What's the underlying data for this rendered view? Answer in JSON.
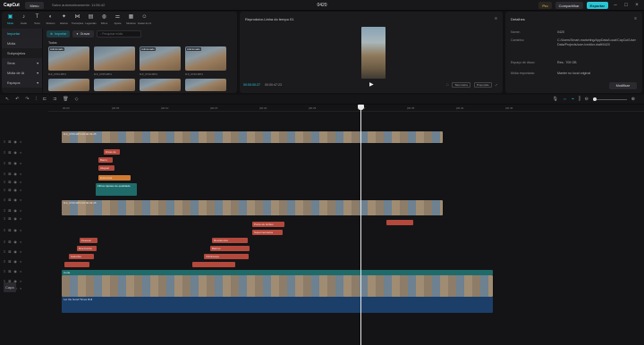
{
  "app": {
    "logo": "CapCut",
    "menu": "Menu",
    "save_status": "Salvo automaticamente: 11:56:42",
    "project": "0420"
  },
  "topbar": {
    "pro": "Pro",
    "share": "Compartilhar",
    "export": "Exportar"
  },
  "tools": [
    {
      "icon": "▣",
      "label": "Mídia"
    },
    {
      "icon": "♪",
      "label": "Áudio"
    },
    {
      "icon": "T",
      "label": "Texto"
    },
    {
      "icon": "◐",
      "label": "Stickers"
    },
    {
      "icon": "✦",
      "label": "Efeitos"
    },
    {
      "icon": "⋈",
      "label": "Transições"
    },
    {
      "icon": "▤",
      "label": "Legendas"
    },
    {
      "icon": "◍",
      "label": "Filtros"
    },
    {
      "icon": "⚌",
      "label": "Ajuste"
    },
    {
      "icon": "▦",
      "label": "Modelos"
    },
    {
      "icon": "☺",
      "label": "Avatar de IA"
    }
  ],
  "media_sidebar": [
    {
      "label": "Importar",
      "active": true
    },
    {
      "label": "Mídia",
      "active": false,
      "sub": true
    },
    {
      "label": "Subprojetos",
      "active": false
    },
    {
      "label": "Seus",
      "active": false,
      "caret": "▾",
      "sub": true
    },
    {
      "label": "Mídia de IA",
      "active": false,
      "caret": "▾",
      "sub": true
    },
    {
      "label": "Espaços",
      "active": false,
      "caret": "▾",
      "sub": true
    }
  ],
  "media_main": {
    "import_btn": "Importar",
    "record_btn": "Gravar",
    "search_placeholder": "Pesquisar mídia",
    "filter_label": "Todos",
    "items": [
      {
        "badge": "Adicionado",
        "name": "DJI_0703.MP4"
      },
      {
        "badge": "",
        "name": "DJI_0705.MP4"
      },
      {
        "badge": "Adicionado",
        "name": "DJI_0710.MP4"
      },
      {
        "badge": "Adicionado",
        "name": "DJI_0720.MP4"
      }
    ]
  },
  "player": {
    "title": "Reprodutor-Linha do tempo 01",
    "tc_current": "00:00:00:27",
    "tc_total": "00:00:47:23",
    "play": "▶",
    "ratio": "Proporção",
    "fullscreen": "Tela inteira"
  },
  "details": {
    "title": "Detalhes",
    "rows": [
      {
        "k": "Nome:",
        "v": "0420"
      },
      {
        "k": "Caminho:",
        "v": "C:/Users/Smart-marketing/AppData/Local/CapCut/User Data/Projects/com.lveditor.draft/0420"
      },
      {
        "k": "Espaço de disco:",
        "v": "Res.: 709 GB"
      },
      {
        "k": "Mídia importada:",
        "v": "Manter no local original"
      }
    ],
    "modify": "Modificar"
  },
  "ruler": [
    "00:00",
    "|00:05",
    "|00:10",
    "|00:15",
    "|00:20",
    "|00:25",
    "|00:30",
    "|00:35",
    "|00:40",
    "|00:45"
  ],
  "clips": {
    "top_video": "DJI_0705.MP4 00:00:33:25",
    "text_items": [
      "Dicas de",
      "Bairro",
      "Aluguel",
      "Entrevista"
    ],
    "texts2": [
      "Ponto de ônibus",
      "Supermercados",
      "Pessoal",
      "Residencial",
      "Rua bonita",
      "Bairros",
      "Subúrbio",
      "Vizinhança"
    ],
    "effects": [
      "Filtros",
      "Ajustes de qualidade",
      "Corte"
    ],
    "filter": "Filtros   Ajustes de qualidade",
    "audio": "Let the Good Times Roll",
    "main_video": "DJI_0720.MP4 00:00:33:25"
  }
}
